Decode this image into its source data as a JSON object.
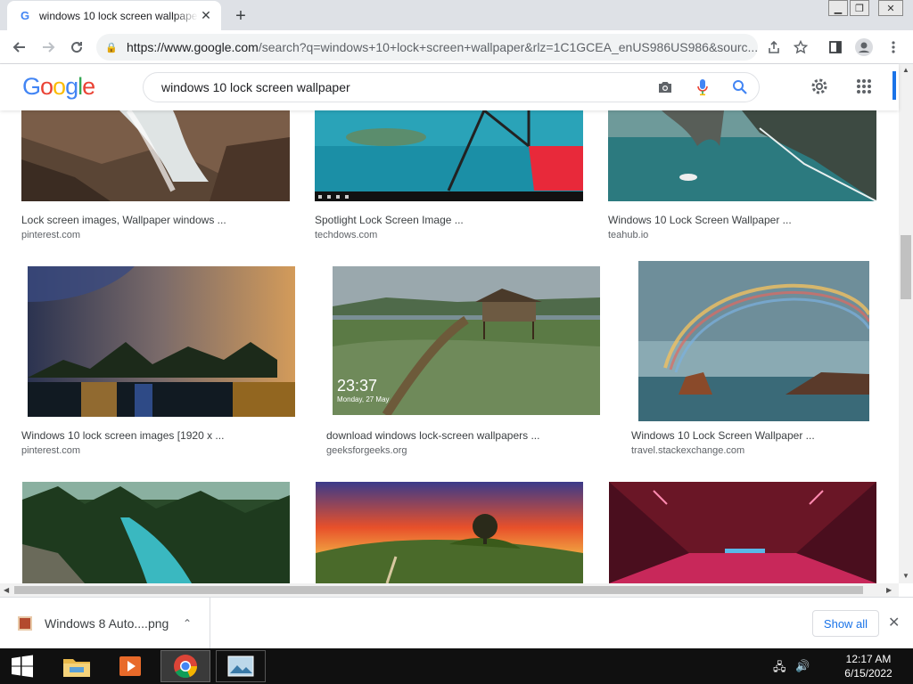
{
  "browser": {
    "tab_title": "windows 10 lock screen wallpaper",
    "url_host": "https://www.google.com",
    "url_rest": "/search?q=windows+10+lock+screen+wallpaper&rlz=1C1GCEA_enUS986US986&sourc..."
  },
  "google": {
    "logo": "Google",
    "query": "windows 10 lock screen wallpaper"
  },
  "results": [
    {
      "caption": "Lock screen images, Wallpaper windows ...",
      "source": "pinterest.com"
    },
    {
      "caption": "Spotlight Lock Screen Image ...",
      "source": "techdows.com"
    },
    {
      "caption": "Windows 10 Lock Screen Wallpaper ...",
      "source": "teahub.io"
    },
    {
      "caption": "Windows 10 lock screen images [1920 x ...",
      "source": "pinterest.com"
    },
    {
      "caption": "download windows lock-screen wallpapers ...",
      "source": "geeksforgeeks.org",
      "clock": "23:37",
      "date": "Monday, 27 May"
    },
    {
      "caption": "Windows 10 Lock Screen Wallpaper ...",
      "source": "travel.stackexchange.com"
    }
  ],
  "download_bar": {
    "filename": "Windows 8 Auto....png",
    "show_all": "Show all"
  },
  "taskbar": {
    "time": "12:17 AM",
    "date": "6/15/2022"
  }
}
